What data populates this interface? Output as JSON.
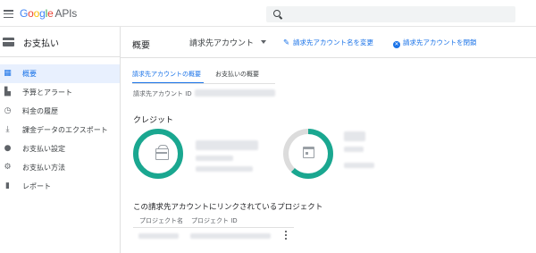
{
  "topbar": {
    "logo_letters": [
      "G",
      "o",
      "o",
      "g",
      "l",
      "e"
    ],
    "logo_suffix": "APIs",
    "search_placeholder": ""
  },
  "sidebar": {
    "title": "お支払い",
    "items": [
      {
        "label": "概要",
        "icon": "grid-icon",
        "active": true
      },
      {
        "label": "予算とアラート",
        "icon": "bar-chart-icon",
        "active": false
      },
      {
        "label": "料金の履歴",
        "icon": "clock-icon",
        "active": false
      },
      {
        "label": "課金データのエクスポート",
        "icon": "export-icon",
        "active": false
      },
      {
        "label": "お支払い設定",
        "icon": "person-icon",
        "active": false
      },
      {
        "label": "お支払い方法",
        "icon": "gear-icon",
        "active": false
      },
      {
        "label": "レポート",
        "icon": "report-icon",
        "active": false
      }
    ]
  },
  "header": {
    "title": "概要",
    "account_select": "請求先アカウント",
    "rename_button": "請求先アカウント名を変更",
    "close_button": "請求先アカウントを閉鎖"
  },
  "tabs": [
    {
      "label": "請求先アカウントの概要",
      "active": true
    },
    {
      "label": "お支払いの概要",
      "active": false
    }
  ],
  "account_id_label": "請求先アカウント ID",
  "credit": {
    "title": "クレジット",
    "ring_color": "#1aa790",
    "remaining_fraction_2": 0.62
  },
  "projects": {
    "title": "この請求先アカウントにリンクされているプロジェクト",
    "columns": [
      "プロジェクト名",
      "プロジェクト ID"
    ]
  },
  "colors": {
    "accent": "#1a73e8",
    "active_bg": "#e8f0fe",
    "teal": "#1aa790"
  }
}
